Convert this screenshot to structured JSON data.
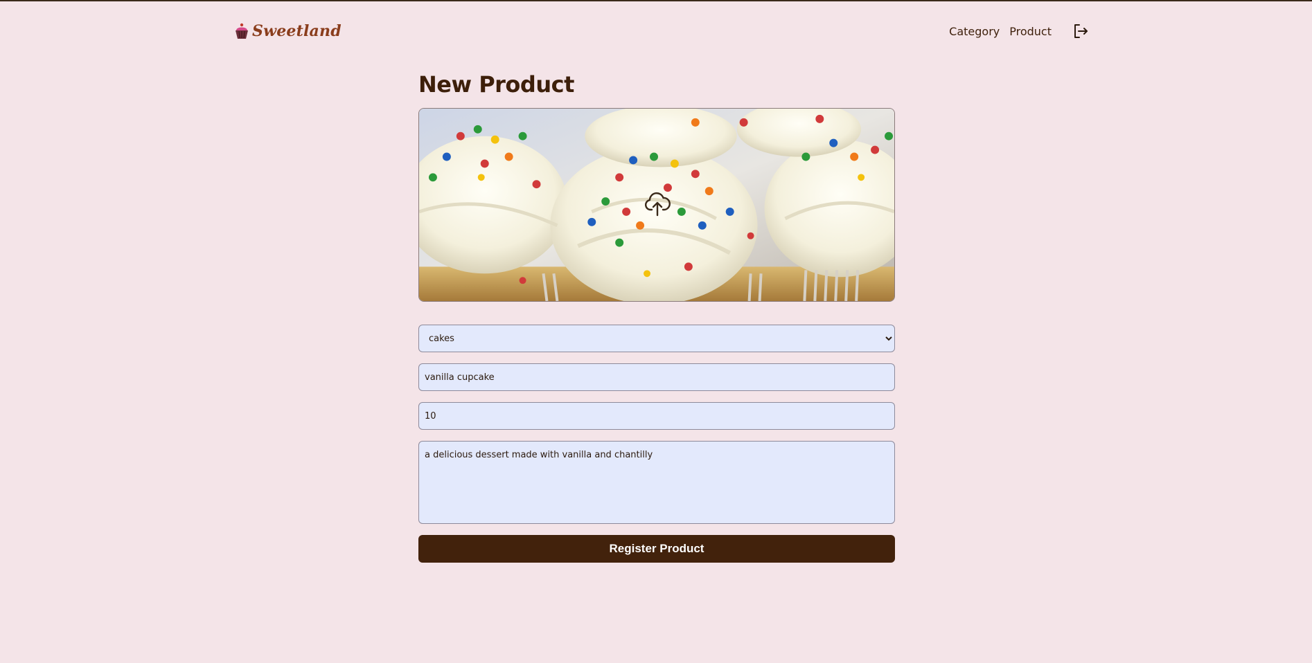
{
  "brand": {
    "name": "Sweetland",
    "accent": "#8a3d1c"
  },
  "nav": {
    "items": [
      {
        "label": "Category"
      },
      {
        "label": "Product"
      }
    ],
    "logout_icon": "logout-icon"
  },
  "page": {
    "title": "New Product"
  },
  "form": {
    "image_upload": {
      "icon": "cloud-upload-icon"
    },
    "category": {
      "value": "cakes",
      "options": [
        "cakes"
      ]
    },
    "name": {
      "value": "vanilla cupcake"
    },
    "price": {
      "value": "10"
    },
    "description": {
      "value": "a delicious dessert made with vanilla and chantilly"
    },
    "submit_label": "Register Product"
  },
  "colors": {
    "background": "#f4e4e8",
    "primary": "#42220c",
    "field_bg": "#e3e9fc"
  }
}
